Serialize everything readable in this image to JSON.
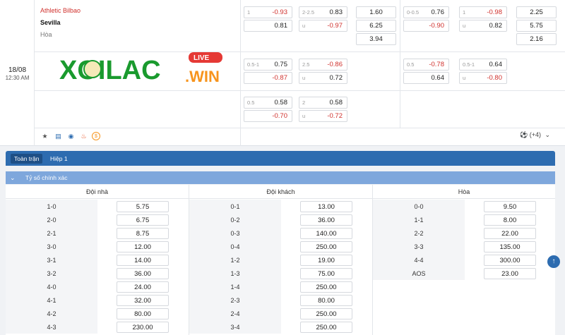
{
  "match": {
    "date": "18/08",
    "time": "12:30 AM",
    "home_team": "Athletic Bilbao",
    "away_team": "Sevilla",
    "draw_label": "Hòa",
    "more_markets": "(+4)"
  },
  "logo": {
    "text_main": "XOILAC",
    "text_live": "LIVE",
    "text_win": ".WIN"
  },
  "odds_rows": [
    {
      "ft_hdp": {
        "h1": "1",
        "v1": "-0.93",
        "h2": "",
        "v2": "0.81"
      },
      "ft_ou": {
        "h1": "2-2.5",
        "v1": "0.83",
        "h2": "u",
        "v2": "-0.97"
      },
      "ft_1x2": [
        "1.60",
        "6.25",
        "3.94"
      ],
      "h1_hdp": {
        "h1": "0-0.5",
        "v1": "0.76",
        "h2": "",
        "v2": "-0.90"
      },
      "h1_ou": {
        "h1": "1",
        "v1": "-0.98",
        "h2": "u",
        "v2": "0.82"
      },
      "h1_1x2": [
        "2.25",
        "5.75",
        "2.16"
      ]
    },
    {
      "ft_hdp": {
        "h1": "0.5-1",
        "v1": "0.75",
        "h2": "",
        "v2": "-0.87"
      },
      "ft_ou": {
        "h1": "2.5",
        "v1": "-0.86",
        "h2": "u",
        "v2": "0.72"
      },
      "h1_hdp": {
        "h1": "0.5",
        "v1": "-0.78",
        "h2": "",
        "v2": "0.64"
      },
      "h1_ou": {
        "h1": "0.5-1",
        "v1": "0.64",
        "h2": "u",
        "v2": "-0.80"
      }
    },
    {
      "ft_hdp": {
        "h1": "0.5",
        "v1": "0.58",
        "h2": "",
        "v2": "-0.70"
      },
      "ft_ou": {
        "h1": "2",
        "v1": "0.58",
        "h2": "u",
        "v2": "-0.72"
      }
    }
  ],
  "tabs": {
    "full": "Toàn trận",
    "half": "Hiệp 1"
  },
  "section_title": "Tỷ số chính xác",
  "correct_score": {
    "home": {
      "title": "Đội nhà",
      "rows": [
        [
          "1-0",
          "5.75"
        ],
        [
          "2-0",
          "6.75"
        ],
        [
          "2-1",
          "8.75"
        ],
        [
          "3-0",
          "12.00"
        ],
        [
          "3-1",
          "14.00"
        ],
        [
          "3-2",
          "36.00"
        ],
        [
          "4-0",
          "24.00"
        ],
        [
          "4-1",
          "32.00"
        ],
        [
          "4-2",
          "80.00"
        ],
        [
          "4-3",
          "230.00"
        ]
      ]
    },
    "away": {
      "title": "Đội khách",
      "rows": [
        [
          "0-1",
          "13.00"
        ],
        [
          "0-2",
          "36.00"
        ],
        [
          "0-3",
          "140.00"
        ],
        [
          "0-4",
          "250.00"
        ],
        [
          "1-2",
          "19.00"
        ],
        [
          "1-3",
          "75.00"
        ],
        [
          "1-4",
          "250.00"
        ],
        [
          "2-3",
          "80.00"
        ],
        [
          "2-4",
          "250.00"
        ],
        [
          "3-4",
          "250.00"
        ]
      ]
    },
    "draw": {
      "title": "Hòa",
      "rows": [
        [
          "0-0",
          "9.50"
        ],
        [
          "1-1",
          "8.00"
        ],
        [
          "2-2",
          "22.00"
        ],
        [
          "3-3",
          "135.00"
        ],
        [
          "4-4",
          "300.00"
        ],
        [
          "AOS",
          "23.00"
        ]
      ]
    }
  },
  "colors": {
    "accent": "#2d6cb0",
    "negative": "#d0312d",
    "logo_green": "#1a9a2e",
    "logo_orange": "#f7941d"
  }
}
